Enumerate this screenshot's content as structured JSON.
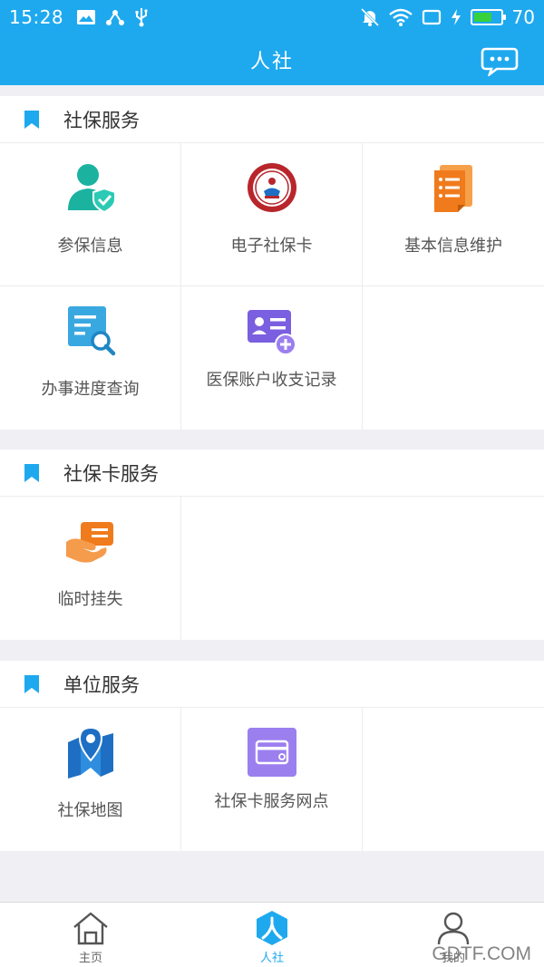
{
  "status_bar": {
    "time": "15:28",
    "battery_percent": "70",
    "battery_level": 0.7,
    "battery_color": "#36d13c",
    "icons": [
      "gallery-icon",
      "share-icon",
      "usb-icon",
      "mute-icon",
      "wifi-icon",
      "screen-icon",
      "charging-icon"
    ]
  },
  "header": {
    "title": "人社",
    "background_color": "#1ea9ef",
    "chat_icon": "chat-bubble-icon"
  },
  "sections": [
    {
      "title": "社保服务",
      "items": [
        {
          "label": "参保信息",
          "icon": "insured-person-icon"
        },
        {
          "label": "电子社保卡",
          "icon": "social-security-card-icon"
        },
        {
          "label": "基本信息维护",
          "icon": "document-list-icon"
        },
        {
          "label": "办事进度查询",
          "icon": "search-document-icon"
        },
        {
          "label": "医保账户收支记录",
          "icon": "medical-account-icon"
        }
      ]
    },
    {
      "title": "社保卡服务",
      "items": [
        {
          "label": "临时挂失",
          "icon": "card-report-loss-icon"
        }
      ]
    },
    {
      "title": "单位服务",
      "items": [
        {
          "label": "社保地图",
          "icon": "map-pin-icon"
        },
        {
          "label": "社保卡服务网点",
          "icon": "card-service-point-icon"
        }
      ]
    }
  ],
  "tab_bar": {
    "tabs": [
      {
        "label": "主页",
        "icon": "home-icon",
        "active": false
      },
      {
        "label": "人社",
        "icon": "renshe-icon",
        "active": true
      },
      {
        "label": "我的",
        "icon": "person-icon",
        "active": false
      }
    ],
    "active_color": "#1ea9ef"
  },
  "watermark": "GDTF.COM"
}
